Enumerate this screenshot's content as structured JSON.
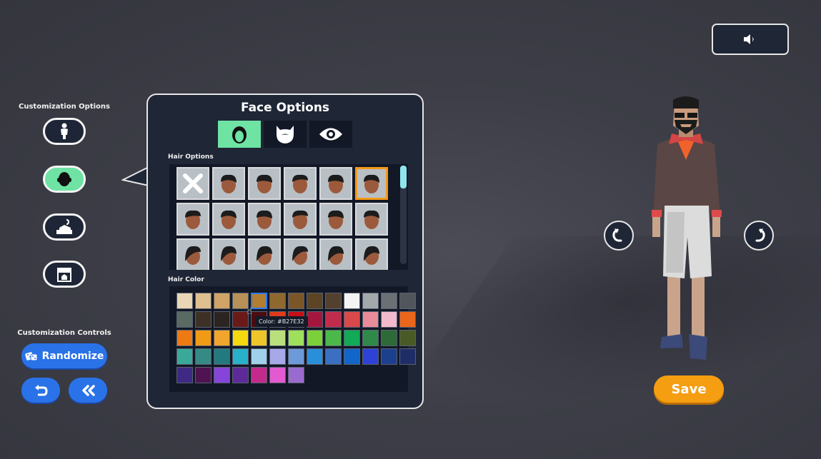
{
  "sidebar": {
    "options_title": "Customization Options",
    "controls_title": "Customization Controls",
    "items": [
      {
        "icon": "body-icon"
      },
      {
        "icon": "face-icon",
        "active": true
      },
      {
        "icon": "clothing-icon"
      },
      {
        "icon": "store-icon"
      }
    ],
    "randomize_label": "Randomize"
  },
  "panel": {
    "title": "Face Options",
    "tabs": [
      {
        "icon": "hair-icon",
        "active": true
      },
      {
        "icon": "beard-icon"
      },
      {
        "icon": "eye-icon"
      }
    ],
    "hair_options_label": "Hair Options",
    "hair_color_label": "Hair Color",
    "tooltip": "Color: #B27E32",
    "hair_items": 18,
    "selected_hair_index": 5,
    "hovered_color_index": 4,
    "colors": [
      "#e8d6b6",
      "#dfc08f",
      "#cfa466",
      "#b89158",
      "#b27e32",
      "#8f6830",
      "#7a5628",
      "#5c4424",
      "#54402e",
      "#f4f4f4",
      "#a3a8ab",
      "#6b7075",
      "#51565d",
      "#596a62",
      "#3d3126",
      "#2b2420",
      "#6a1a18",
      "#4a0d10",
      "#e03a1a",
      "#c80f15",
      "#a3173f",
      "#c12c4c",
      "#d9484b",
      "#e98b9a",
      "#f2b9cc",
      "#e9661a",
      "#ee7a13",
      "#f19a16",
      "#f0a62e",
      "#f5d80f",
      "#efc52a",
      "#b9e07d",
      "#9ee05b",
      "#7cd13a",
      "#4cb84a",
      "#12a957",
      "#2f8a4a",
      "#2d6a37",
      "#4a5a26",
      "#3aa99a",
      "#368a85",
      "#237a7e",
      "#29b1c9",
      "#9fd1ea",
      "#a7a8e8",
      "#6d9ad8",
      "#2a8fdb",
      "#3a6fc1",
      "#1265c9",
      "#2e42d8",
      "#1c3f8e",
      "#1f2d66",
      "#3e2a85",
      "#4e1350",
      "#8744d9",
      "#5e2a9a",
      "#c42a8c",
      "#e35ad0",
      "#9a6bcf"
    ]
  },
  "save_label": "Save",
  "icons": {
    "sound": "speaker-icon",
    "rotate_left": "rotate-left-icon",
    "rotate_right": "rotate-right-icon",
    "undo": "undo-icon",
    "rewind": "rewind-icon",
    "dice": "dice-icon"
  }
}
